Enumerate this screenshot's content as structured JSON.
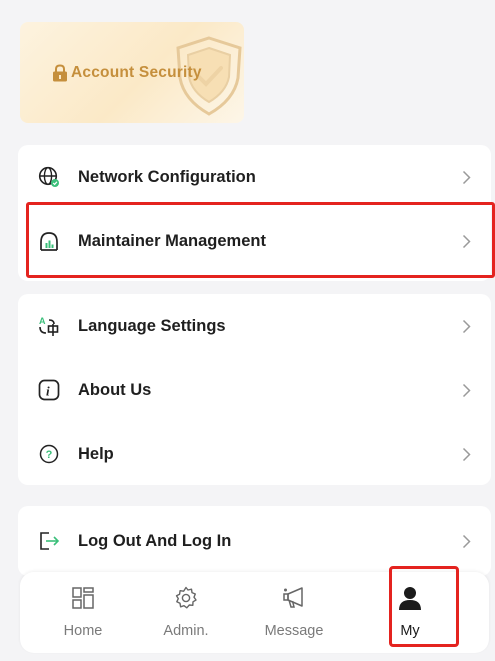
{
  "security": {
    "label": "Account Security"
  },
  "menu": {
    "group1": [
      {
        "label": "Network Configuration",
        "icon": "globe-icon"
      },
      {
        "label": "Maintainer Management",
        "icon": "maintainer-icon"
      }
    ],
    "group2": [
      {
        "label": "Language Settings",
        "icon": "language-icon"
      },
      {
        "label": "About Us",
        "icon": "info-icon"
      },
      {
        "label": "Help",
        "icon": "help-icon"
      }
    ],
    "group3": [
      {
        "label": "Log Out And Log In",
        "icon": "logout-icon"
      }
    ]
  },
  "tabbar": {
    "tabs": [
      {
        "label": "Home",
        "icon": "home-icon"
      },
      {
        "label": "Admin.",
        "icon": "gear-icon"
      },
      {
        "label": "Message",
        "icon": "megaphone-icon"
      },
      {
        "label": "My",
        "icon": "person-icon",
        "active": true
      }
    ]
  },
  "colors": {
    "highlight": "#e4231f",
    "security_text": "#c58f3c",
    "background": "#f4f4f6"
  }
}
